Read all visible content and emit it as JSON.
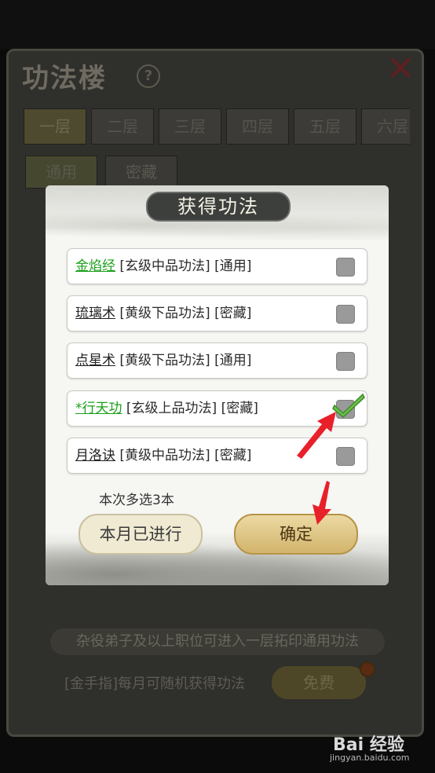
{
  "background": {
    "title": "功法楼",
    "help_icon": "?",
    "close_icon": "✕",
    "floor_tabs": [
      "一层",
      "二层",
      "三层",
      "四层",
      "五层",
      "六层"
    ],
    "category_tabs": [
      "通用",
      "密藏"
    ],
    "rule_text": "杂役弟子及以上职位可进入一层拓印通用功法",
    "tip_text": "[金手指]每月可随机获得功法",
    "free_button": "免费"
  },
  "modal": {
    "title": "获得功法",
    "items": [
      {
        "name": "金焰经",
        "detail": " [玄级中品功法] [通用]",
        "name_color": "green",
        "checked": false
      },
      {
        "name": "琉璃术",
        "detail": " [黄级下品功法] [密藏]",
        "name_color": "black",
        "checked": false
      },
      {
        "name": "点星术",
        "detail": " [黄级下品功法] [通用]",
        "name_color": "black",
        "checked": false
      },
      {
        "name": "*行天功",
        "detail": " [玄级上品功法] [密藏]",
        "name_color": "green",
        "checked": true
      },
      {
        "name": "月洛诀",
        "detail": " [黄级中品功法] [密藏]",
        "name_color": "black",
        "checked": false
      }
    ],
    "note": "本次多选3本",
    "done_button": "本月已进行",
    "confirm_button": "确定"
  },
  "watermark": {
    "brand": "Bai 经验",
    "url": "jingyan.baidu.com"
  },
  "colors": {
    "green_name": "#1aa01a",
    "arrow": "#e8202a",
    "checkmark": "#6cc24a"
  }
}
